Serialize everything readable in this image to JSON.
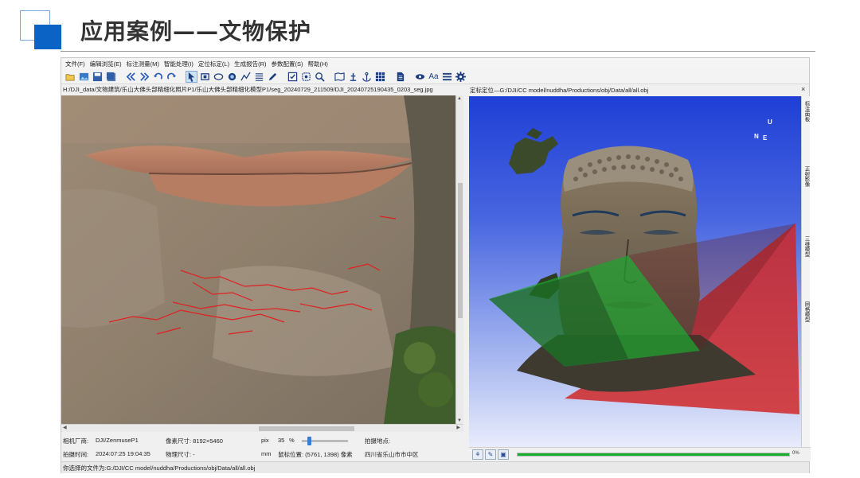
{
  "slide": {
    "title": "应用案例——文物保护"
  },
  "menu": [
    "文件(F)",
    "编辑浏览(E)",
    "标注测量(M)",
    "智能处理(I)",
    "定位标定(L)",
    "生成报告(R)",
    "参数配置(S)",
    "帮助(H)"
  ],
  "toolbar": {
    "text_tool_label": "Aa"
  },
  "left_panel": {
    "path": "H:/DJI_data/文物建筑/乐山大佛头部精细化照片P1/乐山大佛头部精细化模型P1/seg_20240729_211509/DJI_20240725190435_0203_seg.jpg",
    "info": {
      "maker_label": "相机厂商:",
      "maker_value": "DJI/ZenmuseP1",
      "size_label": "像素尺寸: 8192×5460",
      "size_unit": "pix",
      "time_label": "拍摄时间:",
      "time_value": "2024:07:25 19:04:35",
      "phys_label": "物理尺寸: -",
      "phys_unit": "mm",
      "zoom": "35",
      "zoom_unit": "%",
      "mouse_pos": "鼠标位置: (5761, 1398) 像素",
      "location_label": "拍摄地点:",
      "location_value": "四川省乐山市市中区"
    }
  },
  "right_panel": {
    "path": "定标定位—G:/DJI/CC model/nuddha/Productions/obj/Data/all/all.obj",
    "close": "×",
    "compass": {
      "up": "U",
      "n": "N",
      "e": "E"
    },
    "side_tabs": [
      "标注面板",
      "正射影像",
      "三维模型",
      "网格模型"
    ],
    "progress_fraction": 1.0,
    "progress_text": "0%"
  },
  "status": "你选择的文件为:G:/DJI/CC model/nuddha/Productions/obj/Data/all/all.obj",
  "colors": {
    "accent": "#0b63c6",
    "crack": "#e02020",
    "progress": "#16b02d"
  }
}
